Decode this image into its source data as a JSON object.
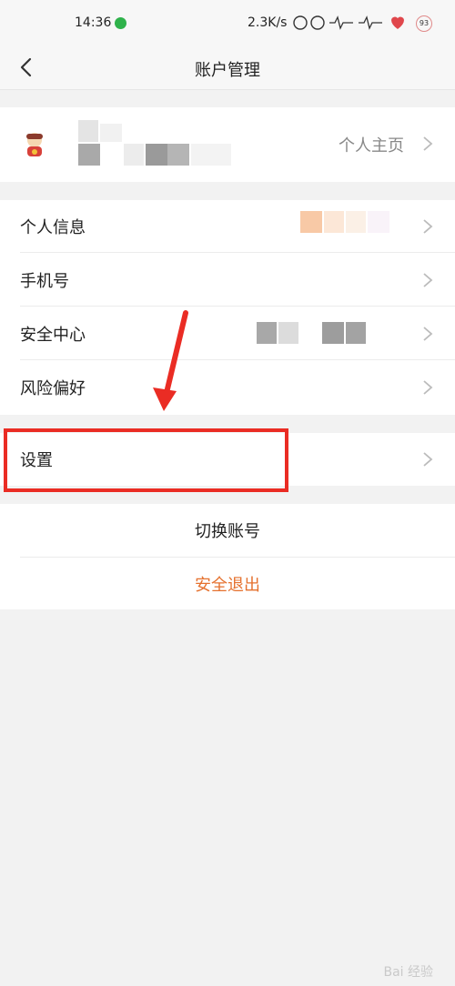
{
  "status_bar": {
    "time": "14:36",
    "speed": "2.3K/s",
    "battery": "93"
  },
  "nav": {
    "title": "账户管理"
  },
  "profile": {
    "home_label": "个人主页"
  },
  "menu": {
    "personal_info": "个人信息",
    "phone": "手机号",
    "security_center": "安全中心",
    "risk_preference": "风险偏好",
    "settings": "设置"
  },
  "actions": {
    "switch_account": "切换账号",
    "logout": "安全退出"
  },
  "watermark": "Bai 经验",
  "colors": {
    "logout": "#e5712e",
    "annotation": "#ea2c24"
  }
}
